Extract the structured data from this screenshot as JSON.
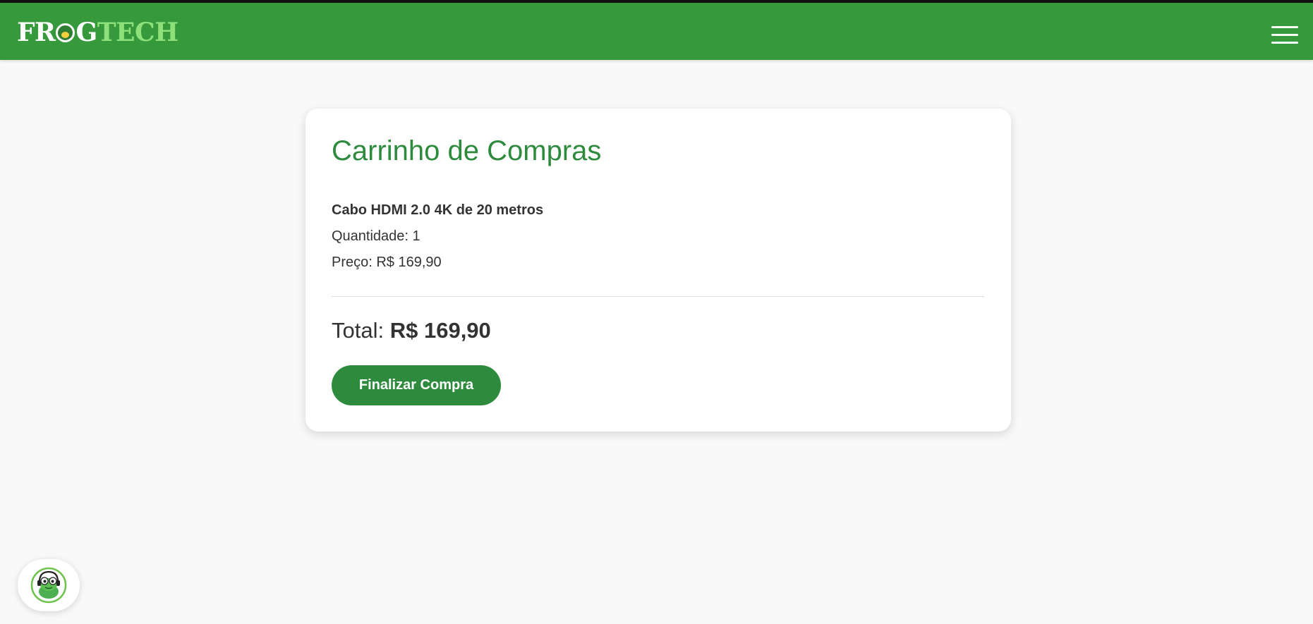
{
  "header": {
    "logo": {
      "part1": "FR",
      "part2": "G",
      "part3": "TECH"
    },
    "menu_icon": "hamburger-menu-icon",
    "brand_color": "#36993b"
  },
  "cart": {
    "title": "Carrinho de Compras",
    "items": [
      {
        "name": "Cabo HDMI 2.0 4K de 20 metros",
        "quantity_text": "Quantidade: 1",
        "price_text": "Preço: R$ 169,90"
      }
    ],
    "total_label": "Total:",
    "total_value": "R$ 169,90",
    "checkout_label": "Finalizar Compra",
    "accent_color": "#2e8b3e"
  },
  "support_widget": {
    "icon": "frog-support-icon"
  }
}
